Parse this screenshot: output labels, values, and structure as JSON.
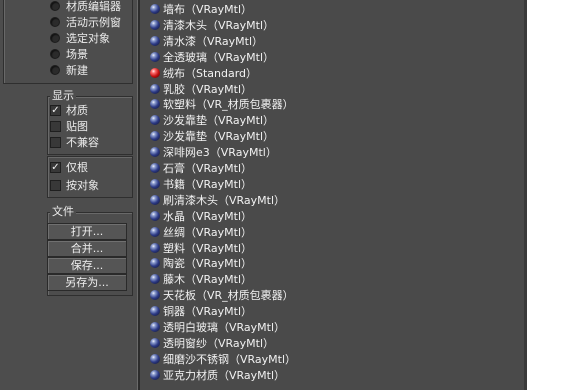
{
  "browse_from": {
    "options": [
      "材质编辑器",
      "活动示例窗",
      "选定对象",
      "场景",
      "新建"
    ]
  },
  "show": {
    "title": "显示",
    "options": [
      {
        "label": "材质",
        "checked": true
      },
      {
        "label": "贴图",
        "checked": false
      },
      {
        "label": "不兼容",
        "checked": false
      }
    ]
  },
  "filter": {
    "options": [
      {
        "label": "仅根",
        "checked": true
      },
      {
        "label": "按对象",
        "checked": false
      }
    ]
  },
  "file": {
    "title": "文件",
    "buttons": [
      "打开...",
      "合并...",
      "保存...",
      "另存为..."
    ]
  },
  "materials": [
    {
      "name": "墙布",
      "type": "（VRayMtl）",
      "icon": "blue-sphere-icon"
    },
    {
      "name": "清漆木头",
      "type": "（VRayMtl）",
      "icon": "blue-sphere-icon"
    },
    {
      "name": "清水漆",
      "type": "（VRayMtl）",
      "icon": "blue-sphere-icon"
    },
    {
      "name": "全透玻璃",
      "type": "（VRayMtl）",
      "icon": "blue-sphere-icon"
    },
    {
      "name": "绒布",
      "type": "（Standard）",
      "icon": "red-sphere-icon"
    },
    {
      "name": "乳胶",
      "type": "（VRayMtl）",
      "icon": "blue-sphere-icon"
    },
    {
      "name": "软塑料",
      "type": "（VR_材质包裹器）",
      "icon": "blue-sphere-icon"
    },
    {
      "name": "沙发靠垫",
      "type": "（VRayMtl）",
      "icon": "blue-sphere-icon"
    },
    {
      "name": "沙发靠垫",
      "type": "（VRayMtl）",
      "icon": "blue-sphere-icon"
    },
    {
      "name": "深啡网e3",
      "type": "（VRayMtl）",
      "icon": "blue-sphere-icon"
    },
    {
      "name": "石膏",
      "type": "（VRayMtl）",
      "icon": "blue-sphere-icon"
    },
    {
      "name": "书籍",
      "type": "（VRayMtl）",
      "icon": "blue-sphere-icon"
    },
    {
      "name": "刷清漆木头",
      "type": "（VRayMtl）",
      "icon": "blue-sphere-icon"
    },
    {
      "name": "水晶",
      "type": "（VRayMtl）",
      "icon": "blue-sphere-icon"
    },
    {
      "name": "丝绸",
      "type": "（VRayMtl）",
      "icon": "blue-sphere-icon"
    },
    {
      "name": "塑料",
      "type": "（VRayMtl）",
      "icon": "blue-sphere-icon"
    },
    {
      "name": "陶瓷",
      "type": "（VRayMtl）",
      "icon": "blue-sphere-icon"
    },
    {
      "name": "藤木",
      "type": "（VRayMtl）",
      "icon": "blue-sphere-icon"
    },
    {
      "name": "天花板",
      "type": "（VR_材质包裹器）",
      "icon": "blue-sphere-icon"
    },
    {
      "name": "铜器",
      "type": "（VRayMtl）",
      "icon": "blue-sphere-icon"
    },
    {
      "name": "透明白玻璃",
      "type": "（VRayMtl）",
      "icon": "blue-sphere-icon"
    },
    {
      "name": "透明窗纱",
      "type": "（VRayMtl）",
      "icon": "blue-sphere-icon"
    },
    {
      "name": "细磨沙不锈钢",
      "type": "（VRayMtl）",
      "icon": "blue-sphere-icon"
    },
    {
      "name": "亚克力材质",
      "type": "（VRayMtl）",
      "icon": "blue-sphere-icon"
    }
  ],
  "colors": {
    "panel": "#4d4d4d",
    "list_bg": "#4a4a4a",
    "text": "#ececec",
    "selected_sphere": "#c41010"
  }
}
